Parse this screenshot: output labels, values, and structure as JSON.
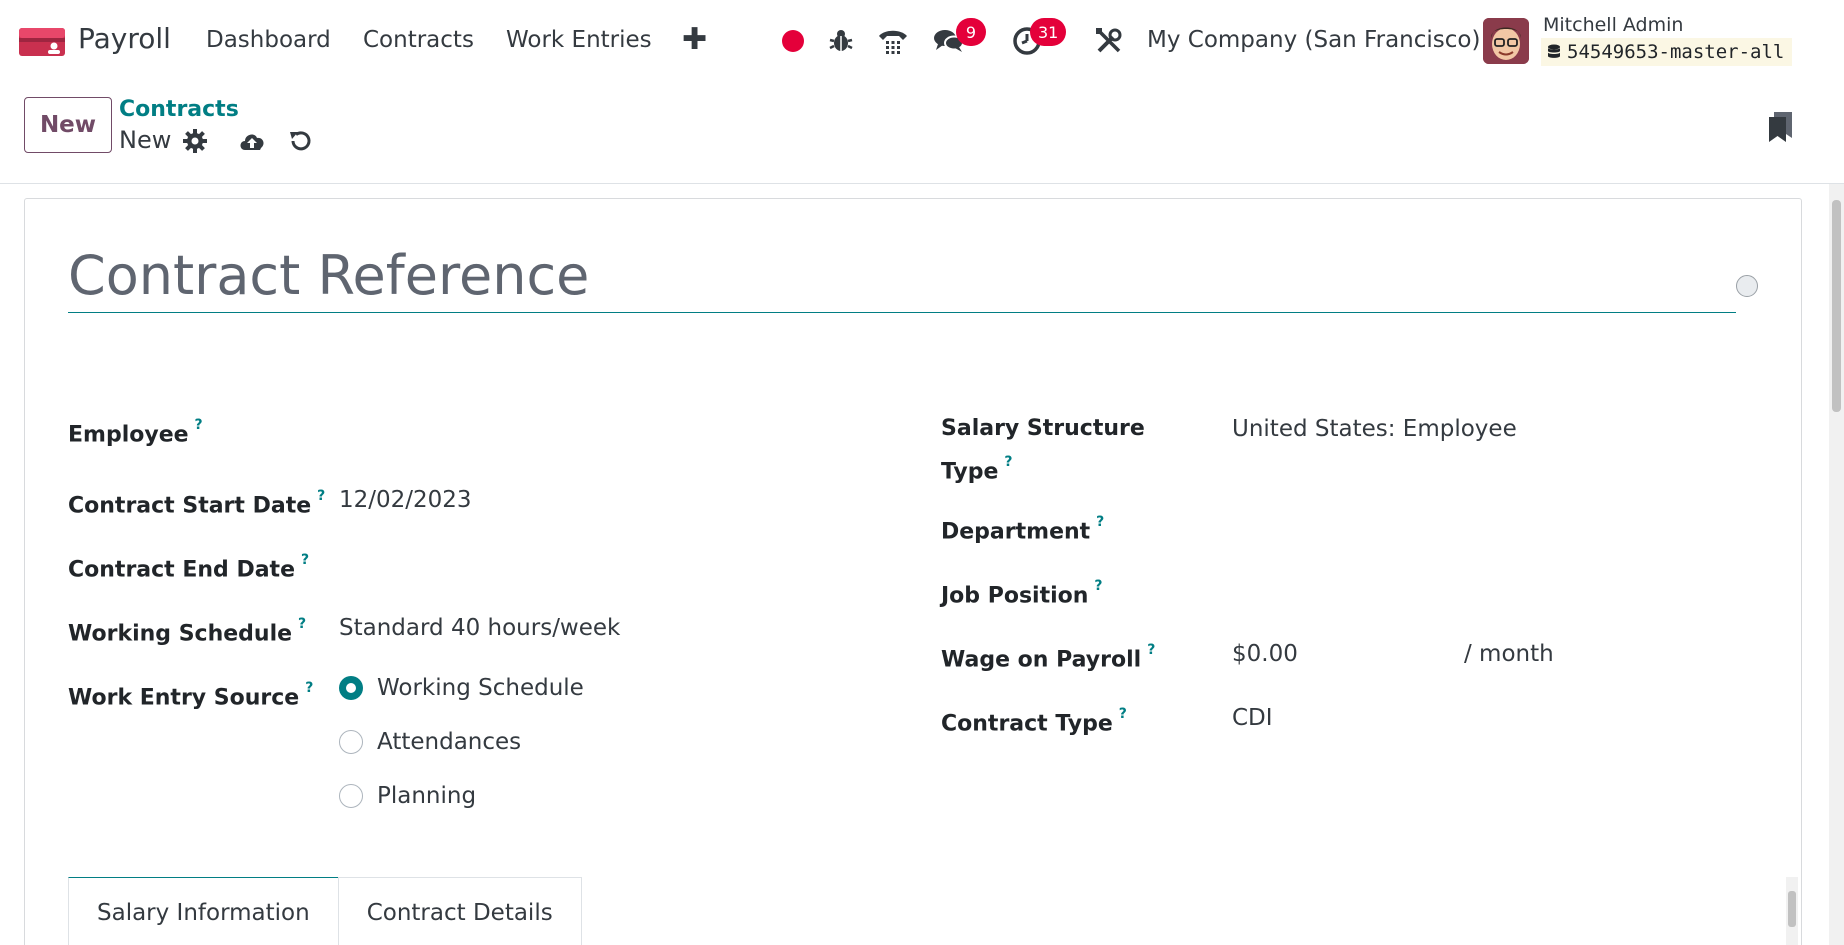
{
  "navbar": {
    "app_name": "Payroll",
    "menu": [
      {
        "label": "Dashboard"
      },
      {
        "label": "Contracts"
      },
      {
        "label": "Work Entries"
      }
    ],
    "messages_badge": "9",
    "activities_badge": "31",
    "company": "My Company (San Francisco)",
    "user_name": "Mitchell Admin",
    "database": "54549653-master-all",
    "accent_color": "#714b67",
    "badge_color": "#e4003a"
  },
  "control_panel": {
    "new_button": "New",
    "breadcrumb_parent": "Contracts",
    "breadcrumb_current": "New"
  },
  "form": {
    "title_placeholder": "Contract Reference",
    "left": {
      "employee": {
        "label": "Employee",
        "help": "?",
        "value": ""
      },
      "start_date": {
        "label": "Contract Start Date",
        "help": "?",
        "value": "12/02/2023"
      },
      "end_date": {
        "label": "Contract End Date",
        "help": "?",
        "value": ""
      },
      "working_schedule": {
        "label": "Working Schedule",
        "help": "?",
        "value": "Standard 40 hours/week"
      },
      "work_entry_source": {
        "label": "Work Entry Source",
        "help": "?",
        "options": [
          {
            "label": "Working Schedule",
            "checked": true
          },
          {
            "label": "Attendances",
            "checked": false
          },
          {
            "label": "Planning",
            "checked": false
          }
        ]
      }
    },
    "right": {
      "salary_structure_type": {
        "label_line1": "Salary Structure",
        "label_line2": "Type",
        "help": "?",
        "value": "United States: Employee"
      },
      "department": {
        "label": "Department",
        "help": "?",
        "value": ""
      },
      "job_position": {
        "label": "Job Position",
        "help": "?",
        "value": ""
      },
      "wage": {
        "label": "Wage on Payroll",
        "help": "?",
        "value": "$0.00",
        "unit": "/ month"
      },
      "contract_type": {
        "label": "Contract Type",
        "help": "?",
        "value": "CDI"
      }
    },
    "tabs": [
      {
        "label": "Salary Information",
        "active": true
      },
      {
        "label": "Contract Details",
        "active": false
      }
    ],
    "accent_color": "#017e84"
  }
}
